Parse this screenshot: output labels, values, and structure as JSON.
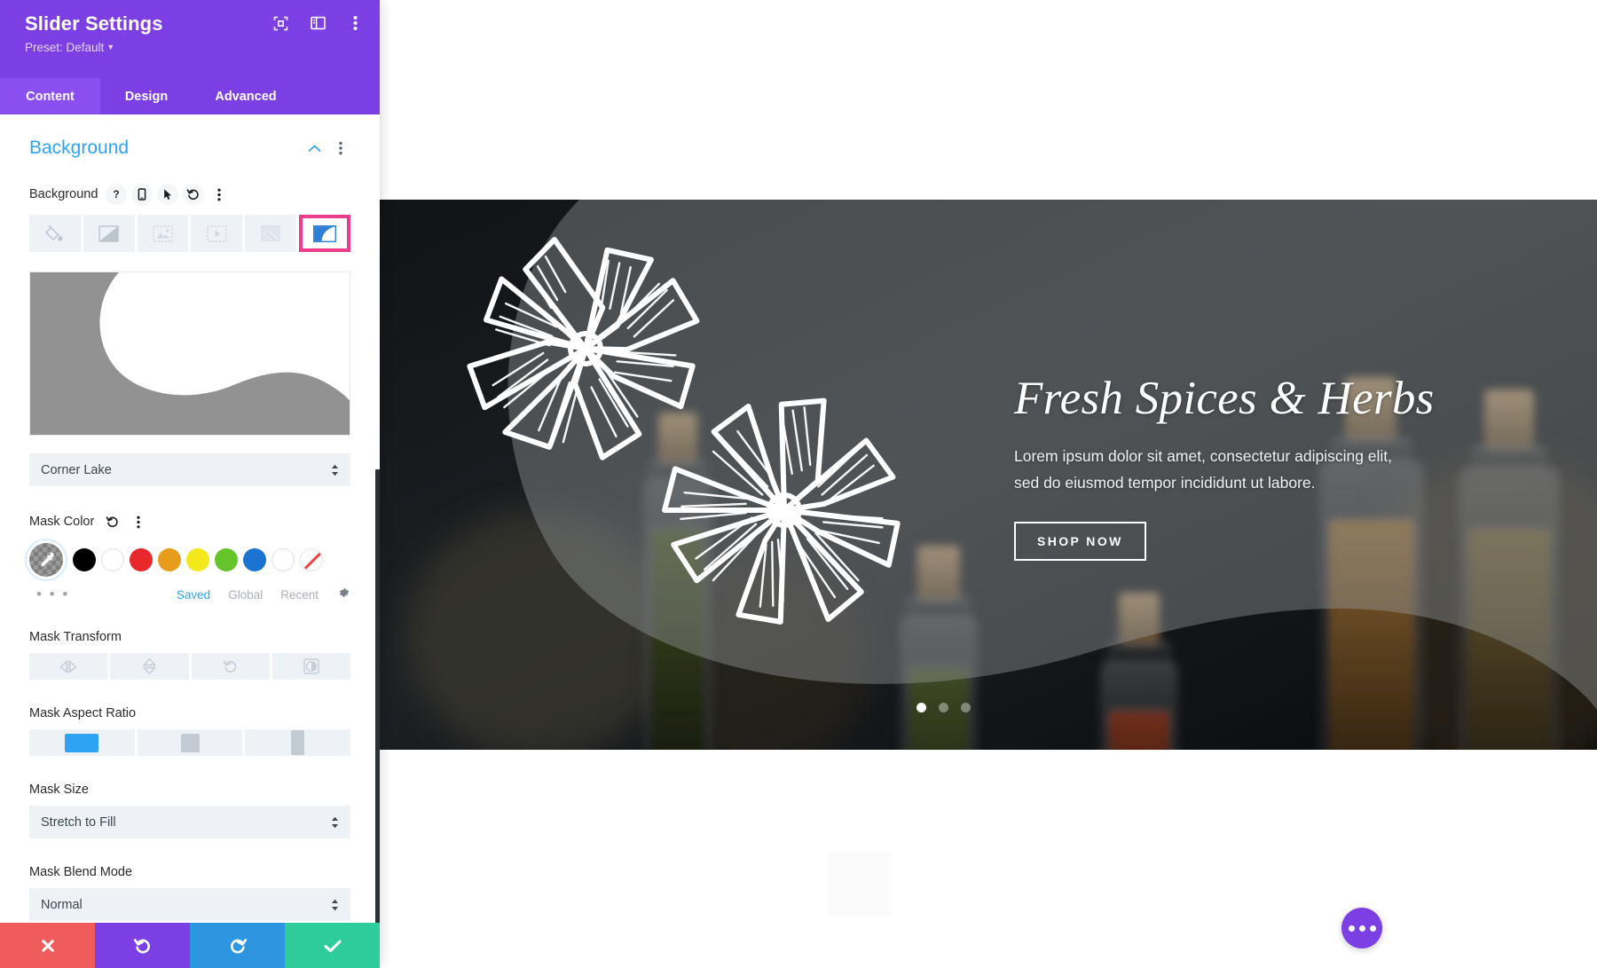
{
  "panel": {
    "title": "Slider Settings",
    "preset": "Preset: Default",
    "header_icons": [
      {
        "name": "expand-icon",
        "glyph": "focus-frame"
      },
      {
        "name": "layout-panel-icon",
        "glyph": "panel"
      },
      {
        "name": "more-options-icon",
        "glyph": "kebab"
      }
    ],
    "tabs": [
      {
        "label": "Content",
        "active": true
      },
      {
        "label": "Design",
        "active": false
      },
      {
        "label": "Advanced",
        "active": false
      }
    ],
    "section": {
      "title": "Background",
      "collapse_icon": "chevron-up-icon",
      "more_icon": "kebab-icon"
    },
    "background_field": {
      "label": "Background",
      "controls": [
        "help-icon",
        "responsive-icon",
        "hover-icon",
        "reset-icon",
        "kebab-icon"
      ],
      "types": [
        {
          "name": "background-color",
          "selected": false
        },
        {
          "name": "background-gradient",
          "selected": false
        },
        {
          "name": "background-image",
          "selected": false
        },
        {
          "name": "background-video",
          "selected": false
        },
        {
          "name": "background-pattern",
          "selected": false
        },
        {
          "name": "background-mask",
          "selected": true
        }
      ],
      "selection_highlight_color": "#EC3C8C"
    },
    "mask_style": {
      "label_hidden": true,
      "value": "Corner Lake"
    },
    "mask_color": {
      "label": "Mask Color",
      "reset_icon": "reset-icon",
      "more_icon": "kebab-icon",
      "selected_swatch": "eyedropper",
      "swatches": [
        {
          "name": "color-picker-eyedropper",
          "color": "transparent",
          "selected": true
        },
        {
          "name": "swatch-black",
          "color": "#000000"
        },
        {
          "name": "swatch-white",
          "color": "#FFFFFF"
        },
        {
          "name": "swatch-red",
          "color": "#E8282B"
        },
        {
          "name": "swatch-orange",
          "color": "#E79C1C"
        },
        {
          "name": "swatch-yellow",
          "color": "#F2E81C"
        },
        {
          "name": "swatch-green",
          "color": "#66C42B"
        },
        {
          "name": "swatch-blue",
          "color": "#1A73D0"
        },
        {
          "name": "swatch-white-2",
          "color": "#FFFFFF"
        },
        {
          "name": "swatch-transparent",
          "color": "none"
        }
      ],
      "more_dots": "• • •",
      "tabs": [
        {
          "label": "Saved",
          "active": true
        },
        {
          "label": "Global",
          "active": false
        },
        {
          "label": "Recent",
          "active": false
        }
      ],
      "settings_icon": "gear-icon"
    },
    "mask_transform": {
      "label": "Mask Transform",
      "buttons": [
        {
          "name": "flip-horizontal-button"
        },
        {
          "name": "flip-vertical-button"
        },
        {
          "name": "rotate-button"
        },
        {
          "name": "invert-button"
        }
      ]
    },
    "mask_aspect_ratio": {
      "label": "Mask Aspect Ratio",
      "options": [
        {
          "name": "aspect-landscape",
          "selected": true
        },
        {
          "name": "aspect-square",
          "selected": false
        },
        {
          "name": "aspect-portrait",
          "selected": false
        }
      ],
      "selected_color": "#2EA3F2"
    },
    "mask_size": {
      "label": "Mask Size",
      "value": "Stretch to Fill"
    },
    "mask_blend_mode": {
      "label": "Mask Blend Mode",
      "value": "Normal"
    },
    "footer": [
      {
        "name": "cancel-button",
        "icon": "close-icon",
        "color": "#F05C5C"
      },
      {
        "name": "undo-button",
        "icon": "undo-icon",
        "color": "#7B3FE4"
      },
      {
        "name": "redo-button",
        "icon": "redo-icon",
        "color": "#2E96E0"
      },
      {
        "name": "save-button",
        "icon": "check-icon",
        "color": "#2ECC9B"
      }
    ]
  },
  "canvas": {
    "slide": {
      "title": "Fresh Spices & Herbs",
      "body_line1": "Lorem ipsum dolor sit amet, consectetur adipiscing elit,",
      "body_line2": "sed do eiusmod tempor incididunt ut labore.",
      "button_label": "SHOP NOW"
    },
    "pagination": {
      "count": 3,
      "active_index": 0
    },
    "fab": {
      "name": "page-settings-fab",
      "icon": "ellipsis-icon",
      "color": "#7B3FE4"
    }
  }
}
